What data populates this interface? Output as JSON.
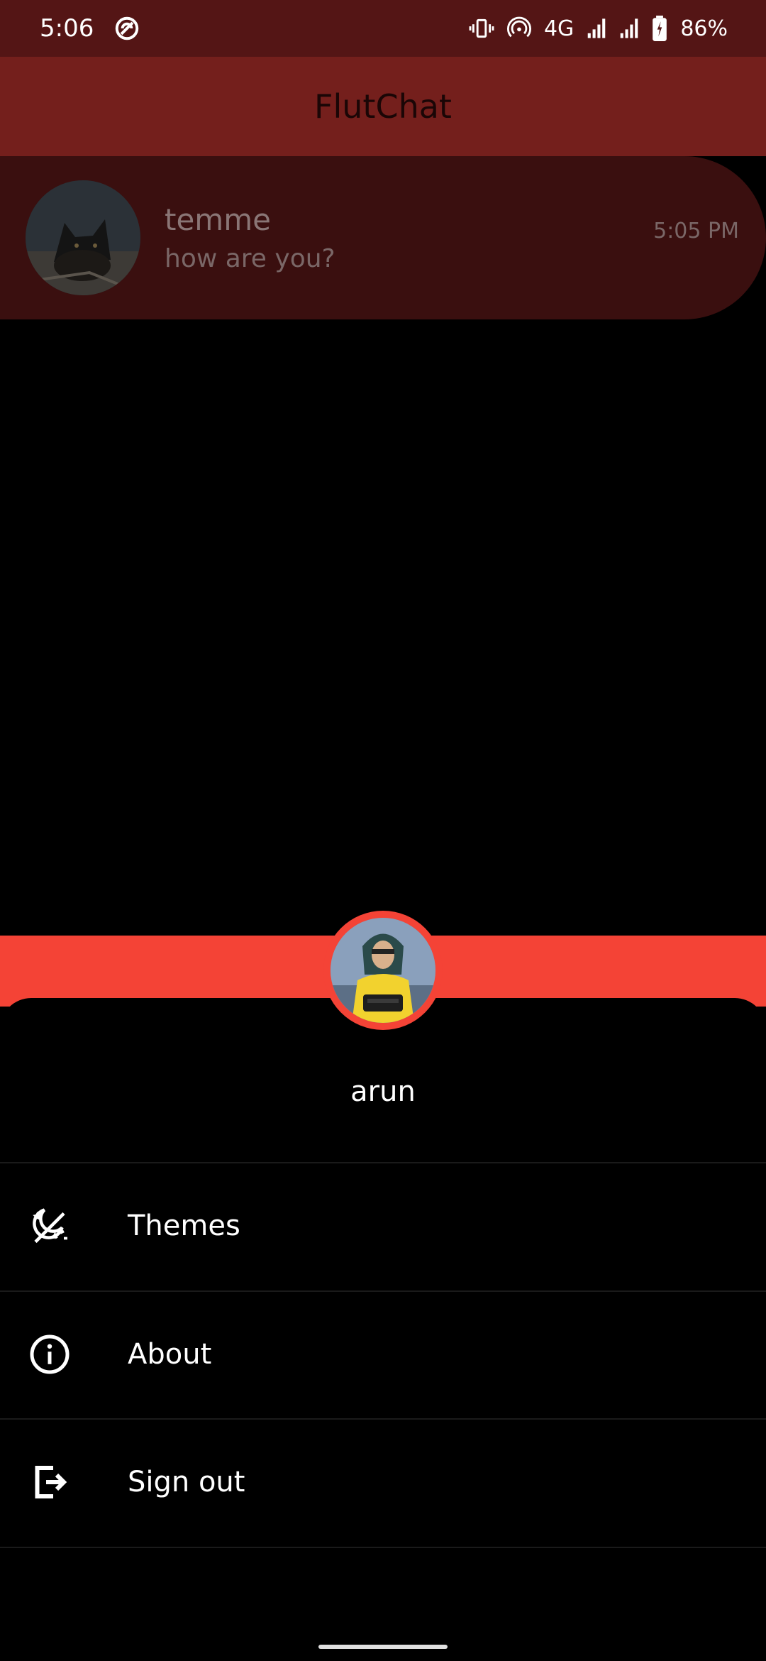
{
  "status_bar": {
    "time": "5:06",
    "network": "4G",
    "battery": "86%",
    "icons": [
      "vpn-key-icon",
      "vibrate-icon",
      "hotspot-icon",
      "signal-icon",
      "signal-icon",
      "battery-icon"
    ]
  },
  "app_bar": {
    "title": "FlutChat"
  },
  "chats": [
    {
      "name": "temme",
      "last_message": "how are you?",
      "time": "5:05 PM",
      "avatar": "cat-photo"
    }
  ],
  "drawer": {
    "profile": {
      "name": "arun",
      "avatar": "user-photo"
    },
    "items": [
      {
        "label": "Themes",
        "icon": "theme-sun-moon-icon"
      },
      {
        "label": "About",
        "icon": "info-icon"
      },
      {
        "label": "Sign out",
        "icon": "logout-icon"
      }
    ]
  },
  "colors": {
    "status_bar": "#541515",
    "app_bar": "#741f1c",
    "chat_tile": "#3a0f0f",
    "accent": "#f44336",
    "background": "#000000"
  }
}
